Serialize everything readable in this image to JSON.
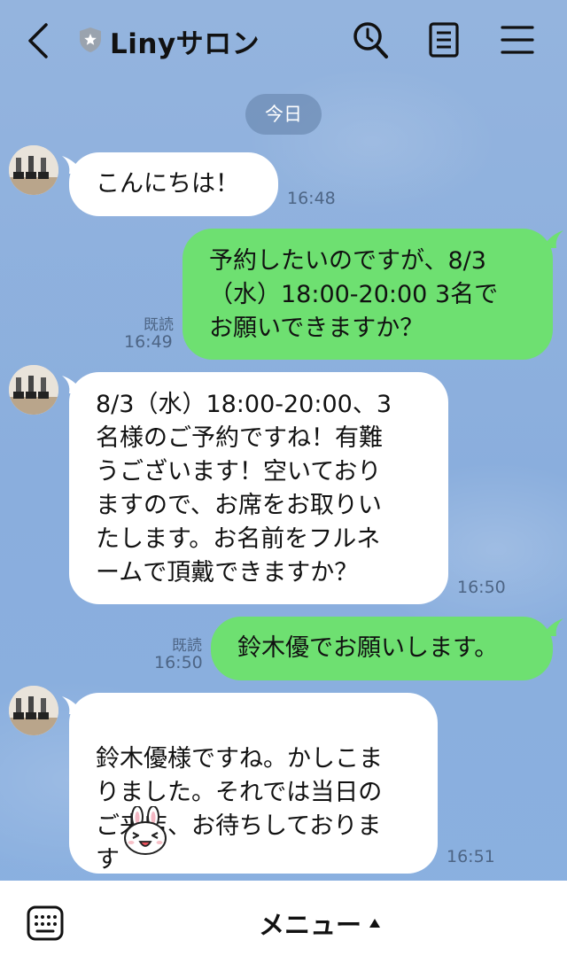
{
  "header": {
    "title": "Linyサロン",
    "icons": [
      "back-arrow-icon",
      "shield-star-icon",
      "search-icon",
      "notes-icon",
      "hamburger-menu-icon"
    ]
  },
  "date_separator": "今日",
  "messages": [
    {
      "side": "in",
      "text": "こんにちは！",
      "time": "16:48"
    },
    {
      "side": "out",
      "text": "予約したいのですが、8/3\n（水）18:00-20:00 3名で\nお願いできますか？",
      "read": "既読",
      "time": "16:49"
    },
    {
      "side": "in",
      "text": "8/3（水）18:00-20:00、3\n名様のご予約ですね！有難\nうございます！空いており\nますので、お席をお取りい\nたします。お名前をフルネ\nームで頂戴できますか？",
      "time": "16:50"
    },
    {
      "side": "out",
      "text": "鈴木優でお願いします。",
      "read": "既読",
      "time": "16:50"
    },
    {
      "side": "in",
      "text": "鈴木優様ですね。かしこま\nりました。それでは当日の\nご来店、お待ちしておりま\nす",
      "time": "16:51",
      "sticker": "rabbit-emoji-icon"
    }
  ],
  "bottom_bar": {
    "menu_label": "メニュー",
    "icons": [
      "keyboard-icon",
      "triangle-up-icon"
    ]
  },
  "colors": {
    "background": "#8fb0dc",
    "incoming_bubble": "#ffffff",
    "outgoing_bubble": "#6ee071",
    "date_pill": "#6e8cb4",
    "meta_text": "#4d6585"
  }
}
